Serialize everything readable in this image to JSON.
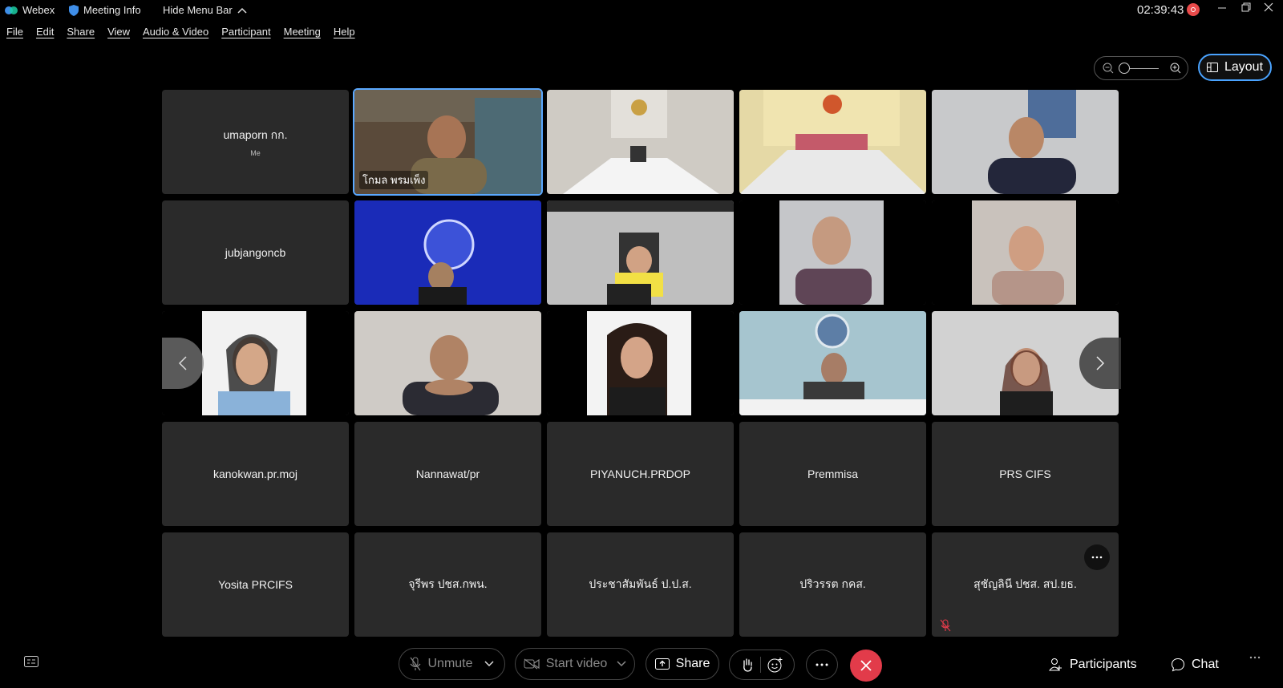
{
  "titlebar": {
    "app_name": "Webex",
    "meeting_info": "Meeting Info",
    "hide_menu": "Hide Menu Bar",
    "time": "02:39:43"
  },
  "menu": [
    "File",
    "Edit",
    "Share",
    "View",
    "Audio & Video",
    "Participant",
    "Meeting",
    "Help"
  ],
  "view": {
    "layout_label": "Layout"
  },
  "tiles": [
    {
      "name": "umaporn กก.",
      "sub": "Me",
      "video": false
    },
    {
      "name": "โกมล พรมเพ็ง",
      "video": true
    },
    {
      "name": "",
      "video": true
    },
    {
      "name": "",
      "video": true
    },
    {
      "name": "",
      "video": true
    },
    {
      "name": "jubjangoncb",
      "video": false
    },
    {
      "name": "",
      "video": true
    },
    {
      "name": "",
      "video": true
    },
    {
      "name": "",
      "video": true
    },
    {
      "name": "",
      "video": true
    },
    {
      "name": "",
      "video": true
    },
    {
      "name": "",
      "video": true
    },
    {
      "name": "",
      "video": true
    },
    {
      "name": "",
      "video": true
    },
    {
      "name": "",
      "video": true
    },
    {
      "name": "kanokwan.pr.moj",
      "video": false
    },
    {
      "name": "Nannawat/pr",
      "video": false
    },
    {
      "name": "PIYANUCH.PRDOP",
      "video": false
    },
    {
      "name": "Premmisa",
      "video": false
    },
    {
      "name": "PRS CIFS",
      "video": false
    },
    {
      "name": "Yosita PRCIFS",
      "video": false
    },
    {
      "name": "จุรีพร ปชส.กพน.",
      "video": false
    },
    {
      "name": "ประชาสัมพันธ์ ป.ป.ส.",
      "video": false
    },
    {
      "name": "ปริวรรต กคส.",
      "video": false
    },
    {
      "name": "สุชัญลินี ปชส. สป.ยธ.",
      "video": false
    }
  ],
  "controls": {
    "unmute": "Unmute",
    "start_video": "Start video",
    "share": "Share",
    "participants": "Participants",
    "chat": "Chat"
  },
  "colors": {
    "accent": "#4aa3ff",
    "leave": "#e23b4a",
    "tile_bg": "#2a2a2a"
  }
}
